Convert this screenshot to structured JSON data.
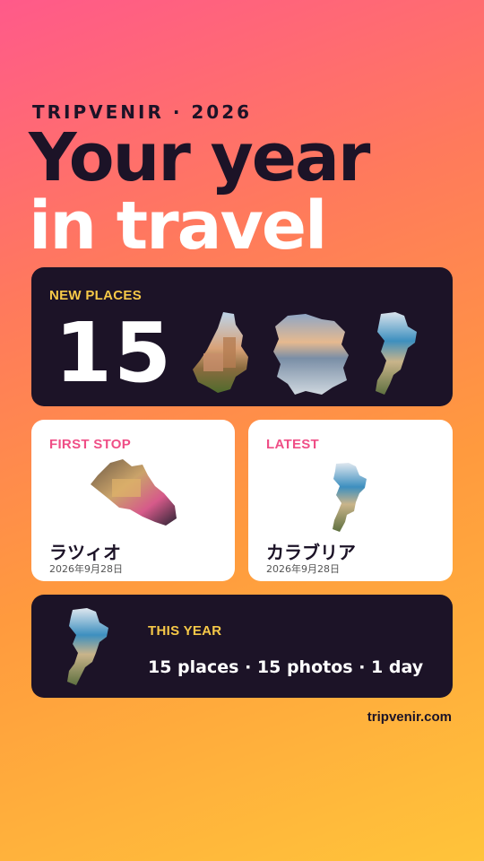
{
  "header": {
    "eyebrow": "TRIPVENIR · 2026",
    "title_line1": "Your year",
    "title_line2": "in travel"
  },
  "new_places": {
    "label": "NEW PLACES",
    "count": "15"
  },
  "first_stop": {
    "label": "FIRST STOP",
    "name": "ラツィオ",
    "date": "2026年9月28日"
  },
  "latest": {
    "label": "LATEST",
    "name": "カラブリア",
    "date": "2026年9月28日"
  },
  "this_year": {
    "label": "THIS YEAR",
    "summary": "15 places · 15 photos · 1 day"
  },
  "footer": {
    "url": "tripvenir.com"
  },
  "colors": {
    "dark_card": "#1c1327",
    "yellow_label": "#f7c948",
    "pink_label": "#ef4e86"
  }
}
